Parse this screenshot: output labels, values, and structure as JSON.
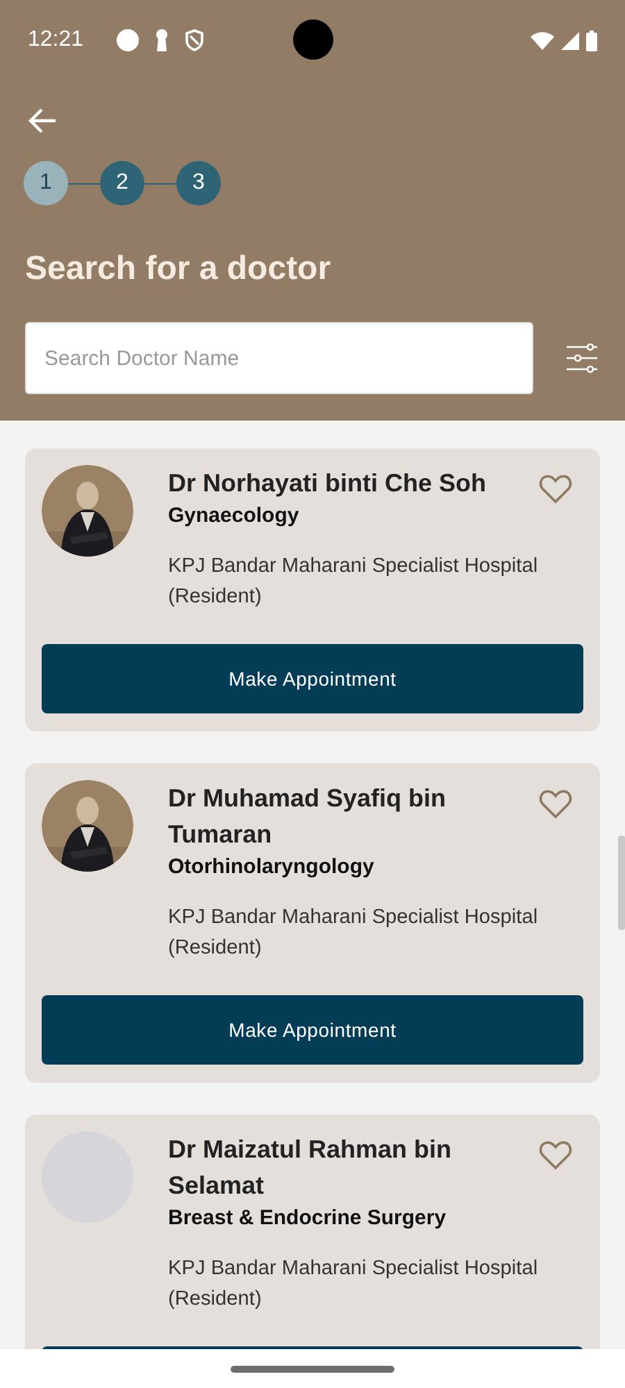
{
  "status_bar": {
    "time": "12:21"
  },
  "stepper": [
    {
      "label": "1",
      "selected": true
    },
    {
      "label": "2",
      "selected": false
    },
    {
      "label": "3",
      "selected": false
    }
  ],
  "title": "Search for a doctor",
  "search": {
    "placeholder": "Search Doctor Name"
  },
  "doctors": [
    {
      "name": "Dr Norhayati binti Che Soh",
      "specialty": "Gynaecology",
      "hospital": "KPJ Bandar Maharani Specialist Hospital (Resident)",
      "kind": "picture",
      "favorite": false,
      "button": "Make Appointment"
    },
    {
      "name": "Dr Muhamad Syafiq bin Tumaran",
      "specialty": "Otorhinolaryngology",
      "hospital": "KPJ Bandar Maharani Specialist Hospital (Resident)",
      "kind": "picture",
      "favorite": false,
      "button": "Make Appointment"
    },
    {
      "name": "Dr Maizatul Rahman bin Selamat",
      "specialty": "Breast & Endocrine Surgery",
      "hospital": "KPJ Bandar Maharani Specialist Hospital (Resident)",
      "kind": "placeholder",
      "favorite": false
    }
  ]
}
